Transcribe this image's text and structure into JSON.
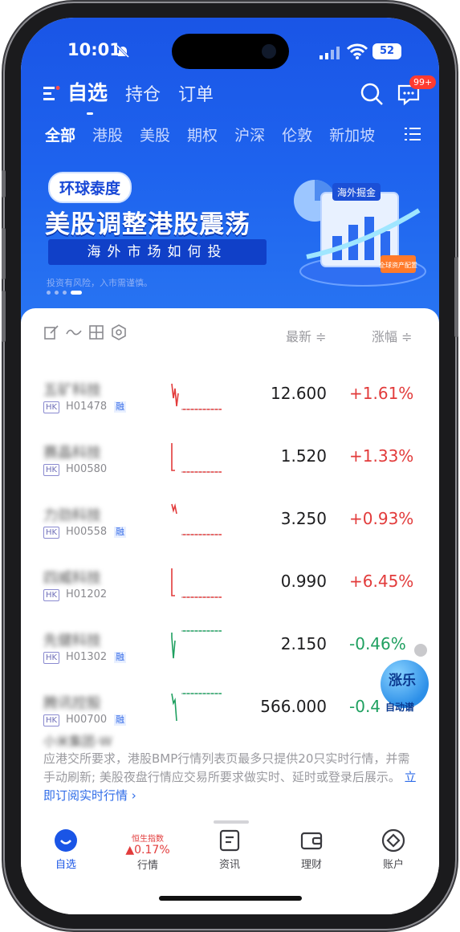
{
  "status_bar": {
    "time": "10:01",
    "battery": "52"
  },
  "top_tabs": [
    "自选",
    "持仓",
    "订单"
  ],
  "message_badge": "99+",
  "market_tabs": [
    "全部",
    "港股",
    "美股",
    "期权",
    "沪深",
    "伦敦",
    "新加坡"
  ],
  "banner": {
    "tag": "环球泰度",
    "title": "美股调整港股震荡",
    "subtitle": "海外市场如何投",
    "note": "投资有风险，入市需谨慎。",
    "art_label": "海外掘金",
    "art_badge": "全球资产配置"
  },
  "list_header": {
    "latest": "最新 ≑",
    "change": "涨幅 ≑"
  },
  "stocks": [
    {
      "name": "五矿科技",
      "market": "HK",
      "code": "H01478",
      "margin": "融",
      "price": "12.600",
      "change": "+1.61%",
      "direction": "up"
    },
    {
      "name": "赛晶科技",
      "market": "HK",
      "code": "H00580",
      "margin": "",
      "price": "1.520",
      "change": "+1.33%",
      "direction": "up"
    },
    {
      "name": "力劲科技",
      "market": "HK",
      "code": "H00558",
      "margin": "融",
      "price": "3.250",
      "change": "+0.93%",
      "direction": "up"
    },
    {
      "name": "四威科技",
      "market": "HK",
      "code": "H01202",
      "margin": "",
      "price": "0.990",
      "change": "+6.45%",
      "direction": "up"
    },
    {
      "name": "先健科技",
      "market": "HK",
      "code": "H01302",
      "margin": "融",
      "price": "2.150",
      "change": "-0.46%",
      "direction": "down"
    },
    {
      "name": "腾讯控股",
      "market": "HK",
      "code": "H00700",
      "margin": "融",
      "price": "566.000",
      "change": "-0.4",
      "direction": "down"
    }
  ],
  "partial_row_name": "小米集团-W",
  "floating": {
    "title": "涨乐",
    "sub": "自动谱"
  },
  "notice": {
    "text": "应港交所要求，港股BMP行情列表页最多只提供20只实时行情，并需手动刷新; 美股夜盘行情应交易所要求做实时、延时或登录后展示。",
    "link": "立即订阅实时行情 ›"
  },
  "tab_bar": {
    "watchlist": "自选",
    "market": "行情",
    "hsi_name": "恒生指数",
    "hsi_value": "▲0.17%",
    "news": "资讯",
    "wealth": "理财",
    "account": "账户"
  }
}
